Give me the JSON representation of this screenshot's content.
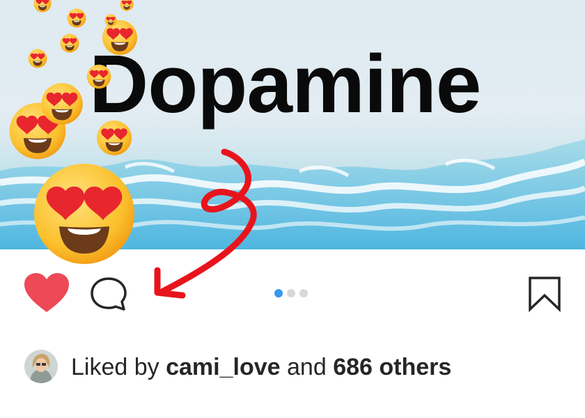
{
  "post": {
    "image_title": "Dopamine",
    "carousel": {
      "count": 3,
      "active_index": 0
    }
  },
  "likes": {
    "prefix": "Liked by",
    "user": "cami_love",
    "middle": "and",
    "others": "686 others"
  },
  "icons": {
    "like": "heart-filled-icon",
    "comment": "comment-bubble-icon",
    "save": "bookmark-icon"
  },
  "colors": {
    "heart": "#ed4956",
    "carousel_active": "#3897f0",
    "annotation_arrow": "#e8141c"
  }
}
